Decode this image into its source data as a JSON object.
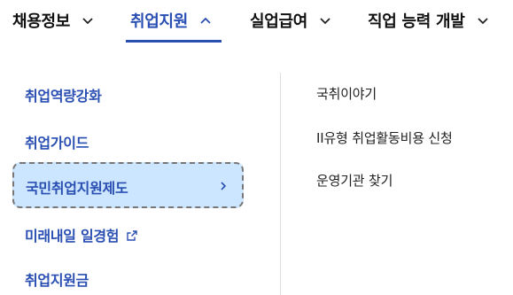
{
  "top_nav": {
    "items": [
      {
        "label": "채용정보",
        "chevron": "chevron-down-icon",
        "active": false
      },
      {
        "label": "취업지원",
        "chevron": "chevron-up-icon",
        "active": true
      },
      {
        "label": "실업급여",
        "chevron": "chevron-down-icon",
        "active": false
      },
      {
        "label": "직업 능력 개발",
        "chevron": "chevron-down-icon",
        "active": false
      }
    ]
  },
  "submenu": {
    "left_items": [
      {
        "label": "취업역량강화"
      },
      {
        "label": "취업가이드"
      },
      {
        "label": "국민취업지원제도",
        "selected": true,
        "icon": "chevron-right-icon"
      },
      {
        "label": "미래내일 일경험",
        "icon": "external-link-icon"
      },
      {
        "label": "취업지원금"
      }
    ],
    "right_items": [
      {
        "label": "국취이야기"
      },
      {
        "label": "II유형 취업활동비용 신청"
      },
      {
        "label": "운영기관 찾기"
      }
    ]
  },
  "colors": {
    "accent": "#2a4fb3",
    "selected_bg": "#cce6ff",
    "text": "#222222"
  }
}
